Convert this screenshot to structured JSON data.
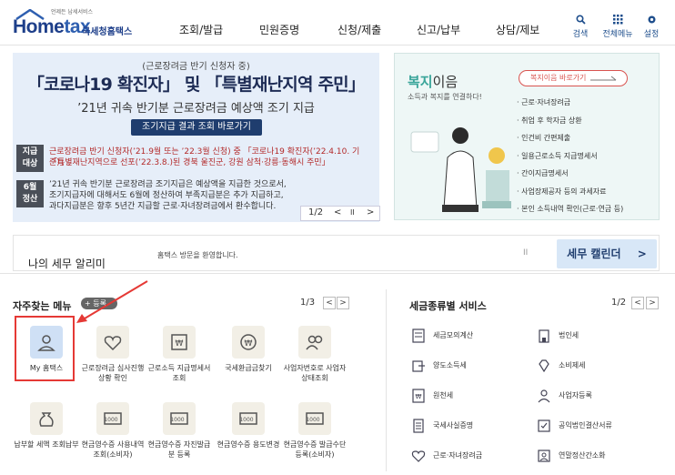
{
  "header": {
    "logo_sub": "언제든 납세서비스",
    "logo_main_a": "Home",
    "logo_main_b": "tax",
    "logo_kr": "국세청홈택스",
    "nav": [
      "조회/발급",
      "민원증명",
      "신청/제출",
      "신고/납부",
      "상담/제보"
    ],
    "tools": [
      {
        "label": "검색",
        "icon": "search-icon"
      },
      {
        "label": "전체메뉴",
        "icon": "grid-icon"
      },
      {
        "label": "설정",
        "icon": "gear-icon"
      }
    ]
  },
  "banner": {
    "line1": "(근로장려금 반기 신청자 중)",
    "line2": "「코로나19 확진자」 및 「특별재난지역 주민」",
    "line3": "’21년 귀속 반기분 근로장려금 예상액 조기 지급",
    "button": "조기지급 결과 조회 바로가기",
    "tag1": "지급\n대상",
    "row1a": "근로장려금 반기 신청자(’21.9월 또는 ’22.3월 신청) 중 「코로나19 확진자(’22.4.10. 기준)」,",
    "row1b": "「특별재난지역으로 선포(’22.3.8.)된 경북 울진군, 강원 삼척·강릉·동해시 주민」",
    "tag2": "6월\n정산",
    "row2a": "’21년 귀속 반기분 근로장려금 조기지급은 예상액을 지급한 것으로서,",
    "row2b": "조기지급자에 대해서도 6월에 정산하여 부족지급분은 추가 지급하고,",
    "row2c": "과다지급분은 향후 5년간 지급할 근로·자녀장려금에서 환수합니다.",
    "page": "1/2",
    "prev": "<",
    "pause": "II",
    "next": ">"
  },
  "welfare": {
    "title_a": "복지",
    "title_b": "이음",
    "subtitle": "소득과 복지를 연결하다!",
    "button": "복지이음 바로가기",
    "items": [
      "근로·자녀장려금",
      "취업 후 학자금 상환",
      "인건비 간편제출",
      "일용근로소득 지급명세서",
      "간이지급명세서",
      "사업장제공자 등의 과세자료",
      "본인 소득내역 확인(근로·연금 등)"
    ]
  },
  "alarm": {
    "title": "나의 세무 알리미",
    "message": "홈택스 방문을 환영합니다.",
    "pause": "II",
    "calendar": "세무 캘린더",
    "calendar_arrow": ">"
  },
  "frequent": {
    "title": "자주찾는 메뉴",
    "plus": "+ 등록",
    "page": "1/3",
    "prev": "<",
    "next": ">",
    "items": [
      {
        "label": "My 홈택스",
        "icon": "person-icon"
      },
      {
        "label": "근로장려금 심사진행상황 확인",
        "icon": "heart-check-icon"
      },
      {
        "label": "근로소득 지급명세서 조회",
        "icon": "document-won-icon"
      },
      {
        "label": "국세환급금찾기",
        "icon": "coin-refund-icon"
      },
      {
        "label": "사업자번호로 사업자상태조회",
        "icon": "people-search-icon"
      },
      {
        "label": "납부할 세액 조회납부",
        "icon": "money-bag-icon"
      },
      {
        "label": "현금영수증 사용내역조회(소비자)",
        "icon": "receipt-icon"
      },
      {
        "label": "현금영수증 자진발급분 등록",
        "icon": "receipt-icon"
      },
      {
        "label": "현금영수증 용도변경",
        "icon": "receipt-icon"
      },
      {
        "label": "현금영수증 발급수단 등록(소비자)",
        "icon": "receipt-icon"
      }
    ]
  },
  "services": {
    "title": "세금종류별 서비스",
    "page": "1/2",
    "prev": "<",
    "next": ">",
    "items": [
      {
        "label": "세금모의계산",
        "icon": "calculator-icon"
      },
      {
        "label": "법인세",
        "icon": "building-icon"
      },
      {
        "label": "양도소득세",
        "icon": "transfer-icon"
      },
      {
        "label": "소비제세",
        "icon": "diamond-icon"
      },
      {
        "label": "원천세",
        "icon": "tax-doc-icon"
      },
      {
        "label": "사업자등록",
        "icon": "person-register-icon"
      },
      {
        "label": "국세사실증명",
        "icon": "certificate-icon"
      },
      {
        "label": "공익법인결산서류",
        "icon": "checklist-icon"
      },
      {
        "label": "근로·자녀장려금",
        "icon": "heart-hand-icon"
      },
      {
        "label": "연말정산간소화",
        "icon": "person-doc-icon"
      }
    ]
  },
  "colors": {
    "brand": "#2e5fb0",
    "highlight": "#e53935",
    "banner_bg": "#e6eef9",
    "welfare_bg": "#eef7f6"
  }
}
